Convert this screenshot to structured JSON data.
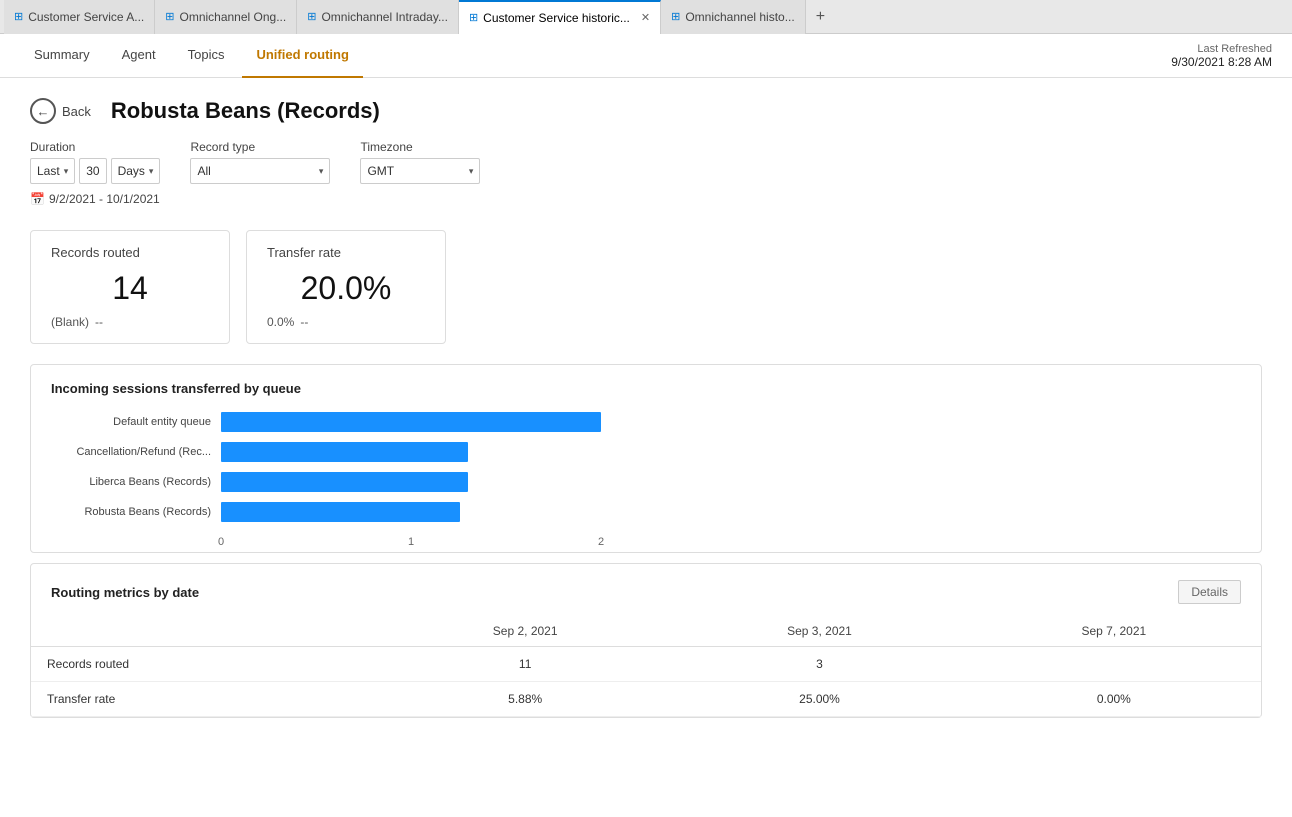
{
  "tabBar": {
    "tabs": [
      {
        "id": "tab1",
        "icon": "⊞",
        "label": "Customer Service A...",
        "active": false,
        "closable": false
      },
      {
        "id": "tab2",
        "icon": "⊞",
        "label": "Omnichannel Ong...",
        "active": false,
        "closable": false
      },
      {
        "id": "tab3",
        "icon": "⊞",
        "label": "Omnichannel Intraday...",
        "active": false,
        "closable": false
      },
      {
        "id": "tab4",
        "icon": "⊞",
        "label": "Customer Service historic...",
        "active": true,
        "closable": true
      },
      {
        "id": "tab5",
        "icon": "⊞",
        "label": "Omnichannel histo...",
        "active": false,
        "closable": false
      }
    ],
    "addLabel": "+"
  },
  "navBar": {
    "tabs": [
      {
        "id": "summary",
        "label": "Summary",
        "active": false
      },
      {
        "id": "agent",
        "label": "Agent",
        "active": false
      },
      {
        "id": "topics",
        "label": "Topics",
        "active": false
      },
      {
        "id": "unified-routing",
        "label": "Unified routing",
        "active": true
      }
    ],
    "lastRefreshed": {
      "label": "Last Refreshed",
      "value": "9/30/2021 8:28 AM"
    }
  },
  "page": {
    "backLabel": "Back",
    "title": "Robusta Beans (Records)"
  },
  "filters": {
    "durationLabel": "Duration",
    "durationLast": "Last",
    "durationValue": "30",
    "durationUnit": "Days",
    "recordTypeLabel": "Record type",
    "recordTypeValue": "All",
    "timezoneLabel": "Timezone",
    "timezoneValue": "GMT",
    "dateRange": "9/2/2021 - 10/1/2021"
  },
  "cards": [
    {
      "title": "Records routed",
      "value": "14",
      "sub1": "(Blank)",
      "sub2": "--"
    },
    {
      "title": "Transfer rate",
      "value": "20.0%",
      "sub1": "0.0%",
      "sub2": "--"
    }
  ],
  "incomingSessions": {
    "title": "Incoming sessions transferred by queue",
    "bars": [
      {
        "label": "Default entity queue",
        "pct": 100,
        "rawValue": 2
      },
      {
        "label": "Cancellation/Refund (Rec...",
        "pct": 65,
        "rawValue": 1.3
      },
      {
        "label": "Liberca Beans (Records)",
        "pct": 65,
        "rawValue": 1.3
      },
      {
        "label": "Robusta Beans (Records)",
        "pct": 63,
        "rawValue": 1.26
      }
    ],
    "axisLabels": [
      "0",
      "1",
      "2"
    ]
  },
  "routingMetrics": {
    "title": "Routing metrics by date",
    "detailsButton": "Details",
    "columns": [
      "",
      "Sep 2, 2021",
      "Sep 3, 2021",
      "Sep 7, 2021"
    ],
    "rows": [
      {
        "label": "Records routed",
        "values": [
          "11",
          "3",
          ""
        ]
      },
      {
        "label": "Transfer rate",
        "values": [
          "5.88%",
          "25.00%",
          "0.00%"
        ]
      }
    ]
  }
}
